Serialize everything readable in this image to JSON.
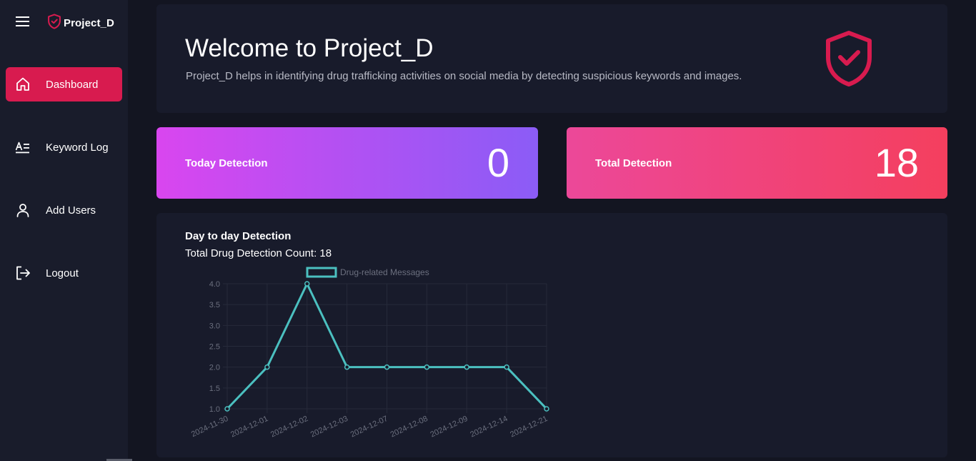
{
  "app": {
    "brand": "Project_D",
    "accent": "#d81b4f"
  },
  "sidebar": {
    "items": [
      {
        "label": "Dashboard",
        "icon": "home-icon",
        "active": true
      },
      {
        "label": "Keyword Log",
        "icon": "text-lines-icon",
        "active": false
      },
      {
        "label": "Add Users",
        "icon": "user-icon",
        "active": false
      },
      {
        "label": "Logout",
        "icon": "logout-icon",
        "active": false
      }
    ]
  },
  "welcome": {
    "title": "Welcome to Project_D",
    "description": "Project_D helps in identifying drug trafficking activities on social media by detecting suspicious keywords and images."
  },
  "stats": {
    "today": {
      "label": "Today Detection",
      "value": "0"
    },
    "total": {
      "label": "Total Detection",
      "value": "18"
    }
  },
  "chart_section": {
    "title": "Day to day Detection",
    "subtitle": "Total Drug Detection Count: 18"
  },
  "chart_data": {
    "type": "line",
    "categories": [
      "2024-11-30",
      "2024-12-01",
      "2024-12-02",
      "2024-12-03",
      "2024-12-07",
      "2024-12-08",
      "2024-12-09",
      "2024-12-14",
      "2024-12-21"
    ],
    "series": [
      {
        "name": "Drug-related Messages",
        "values": [
          1,
          2,
          4,
          2,
          2,
          2,
          2,
          2,
          1
        ],
        "color": "#4bc0c0"
      }
    ],
    "ylim": [
      1,
      4
    ],
    "yticks": [
      "1.0",
      "1.5",
      "2.0",
      "2.5",
      "3.0",
      "3.5",
      "4.0"
    ],
    "legend": "top",
    "grid": true
  }
}
